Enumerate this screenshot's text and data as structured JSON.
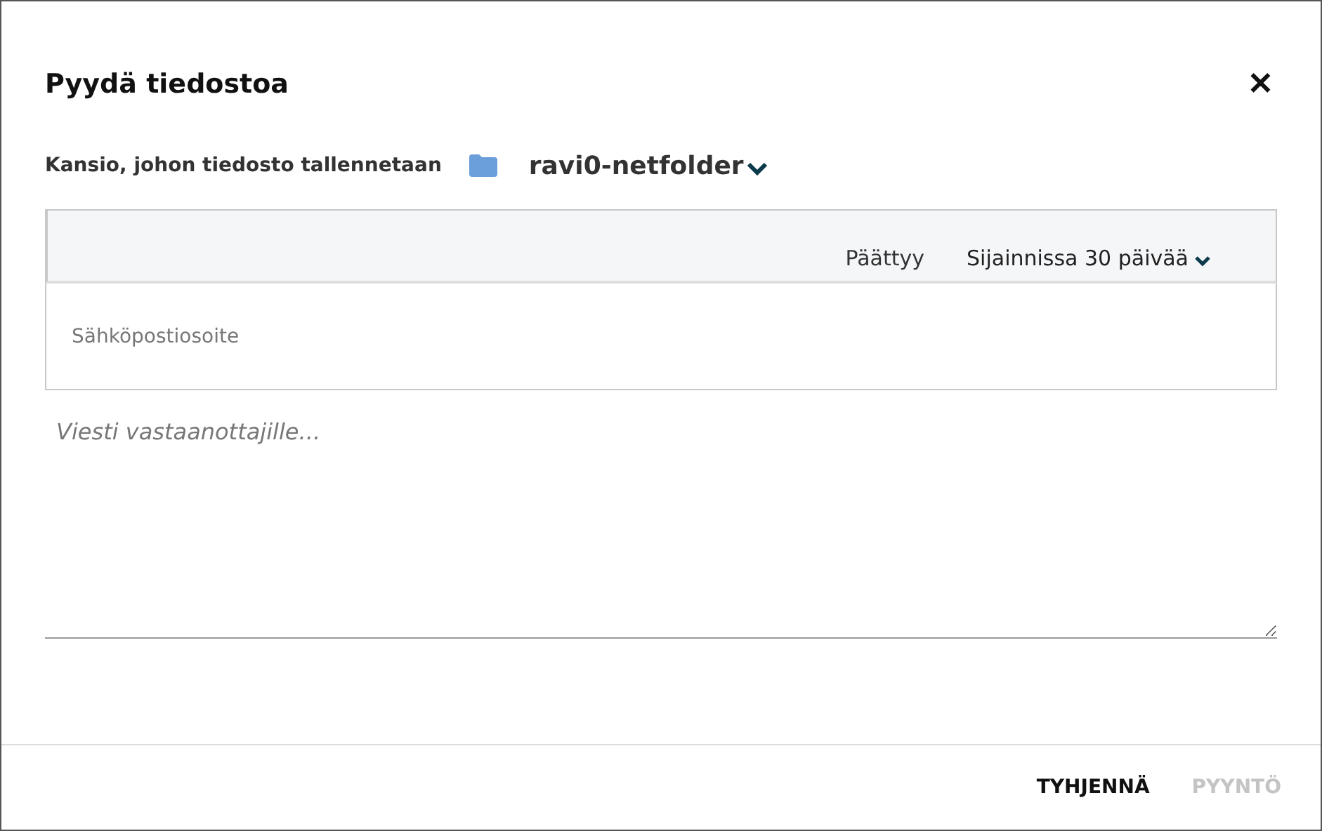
{
  "dialog": {
    "title": "Pyydä tiedostoa",
    "close": "✕"
  },
  "folder": {
    "label": "Kansio, johon tiedosto tallennetaan",
    "name": "ravi0-netfolder"
  },
  "expiry": {
    "label": "Päättyy",
    "value": "Sijainnissa 30 päivää"
  },
  "email": {
    "placeholder": "Sähköpostiosoite"
  },
  "message": {
    "placeholder": "Viesti vastaanottajille..."
  },
  "buttons": [
    {
      "label": "TYHJENNÄ",
      "disabled": false
    },
    {
      "label": "PYYNTÖ",
      "disabled": true
    }
  ]
}
